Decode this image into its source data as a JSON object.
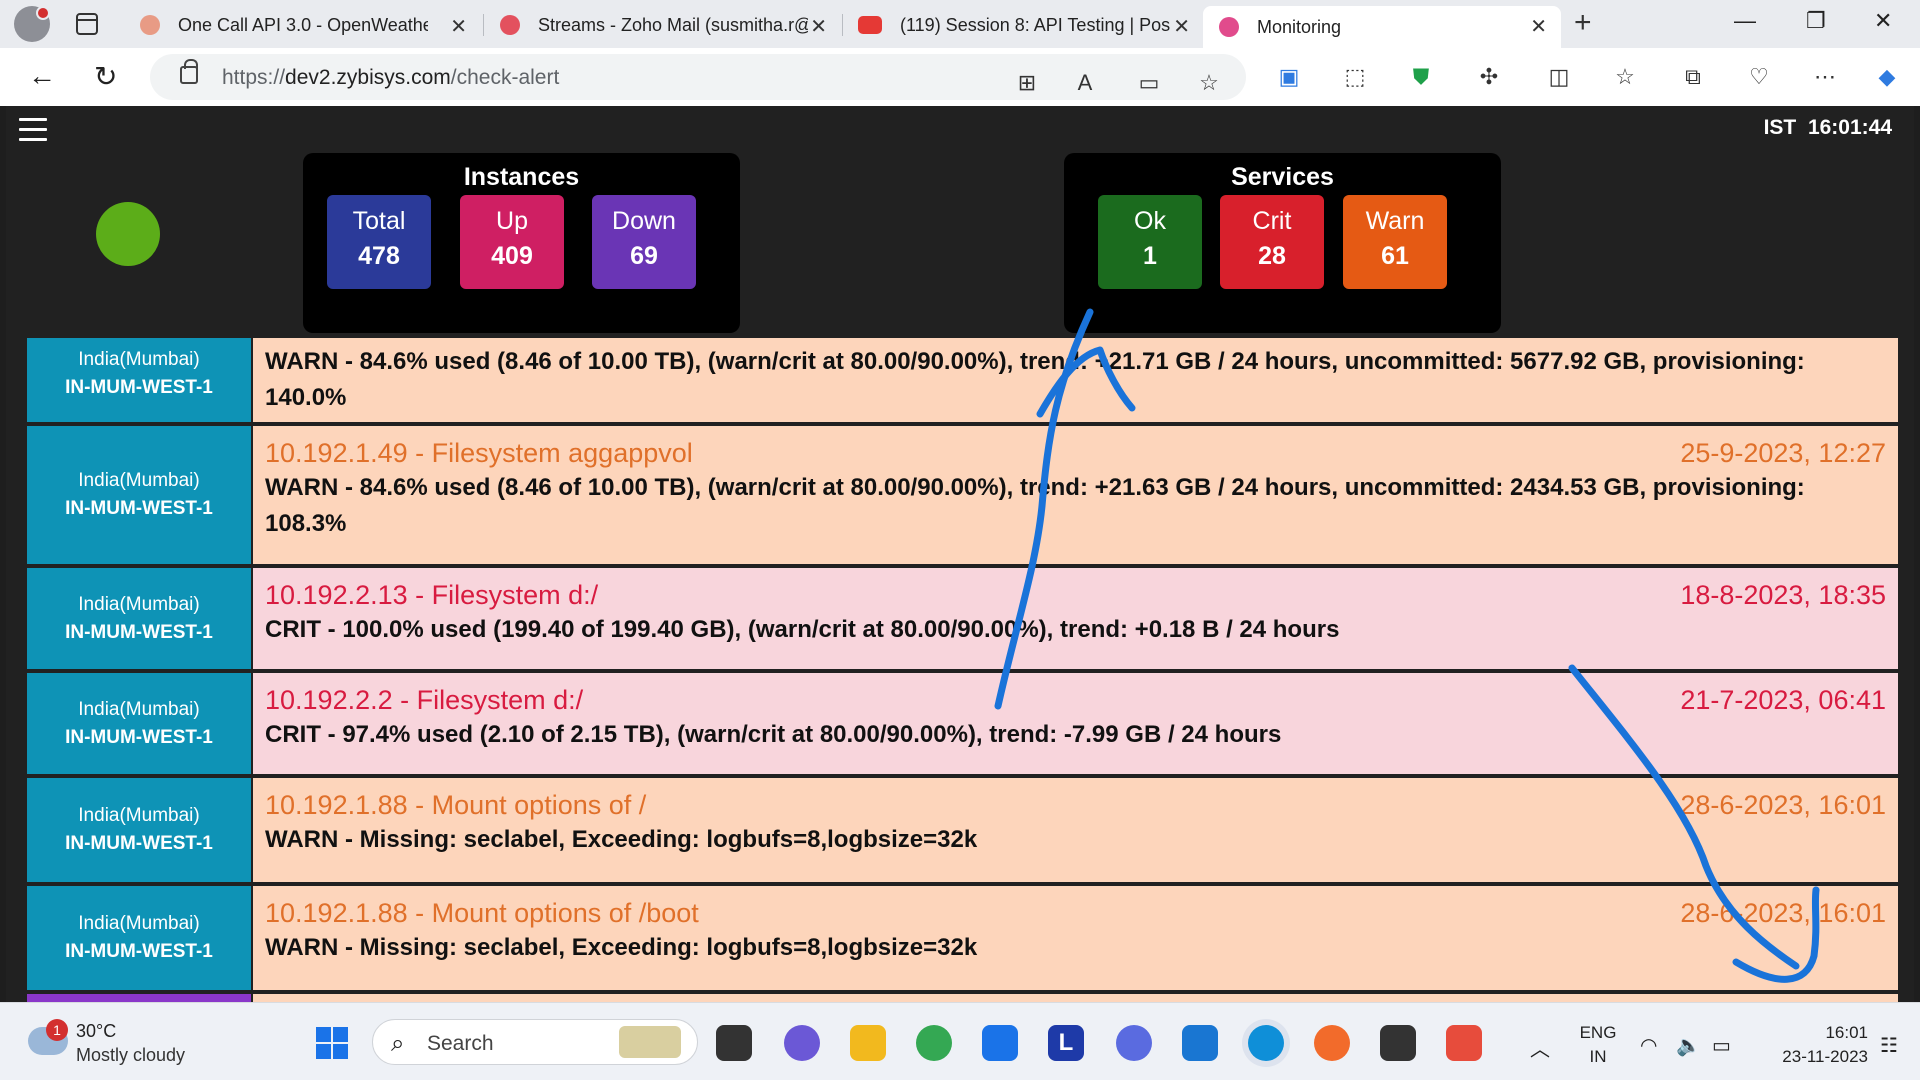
{
  "browser": {
    "tabs": [
      {
        "title": "One Call API 3.0 - OpenWeatherM",
        "favicon_color": "#e89b85"
      },
      {
        "title": "Streams - Zoho Mail (susmitha.r@",
        "favicon_color": "#e3515e"
      },
      {
        "title": "(119) Session 8: API Testing | Post",
        "favicon_color": "#e53935"
      },
      {
        "title": "Monitoring",
        "favicon_color": "#e14b8c"
      }
    ],
    "url_prefix": "https://",
    "url_host": "dev2.zybisys.com",
    "url_path": "/check-alert"
  },
  "header": {
    "timezone": "IST",
    "time": "16:01:44"
  },
  "instances": {
    "title": "Instances",
    "items": [
      {
        "label": "Total",
        "value": "478",
        "color": "#2b3a99"
      },
      {
        "label": "Up",
        "value": "409",
        "color": "#cf1f63"
      },
      {
        "label": "Down",
        "value": "69",
        "color": "#6a35b5"
      }
    ]
  },
  "services": {
    "title": "Services",
    "items": [
      {
        "label": "Ok",
        "value": "1",
        "color": "#1b6b1e"
      },
      {
        "label": "Crit",
        "value": "28",
        "color": "#d8202c"
      },
      {
        "label": "Warn",
        "value": "61",
        "color": "#e55a14"
      }
    ]
  },
  "alerts": [
    {
      "region": "India(Mumbai)",
      "datacenter": "IN-MUM-WEST-1",
      "severity": "warn",
      "title": "",
      "time": "",
      "message": "WARN - 84.6% used (8.46 of 10.00 TB), (warn/crit at 80.00/90.00%), trend: +21.71 GB / 24 hours, uncommitted: 5677.92 GB, provisioning: 140.0%"
    },
    {
      "region": "India(Mumbai)",
      "datacenter": "IN-MUM-WEST-1",
      "severity": "warn",
      "title": "10.192.1.49 - Filesystem aggappvol",
      "time": "25-9-2023, 12:27",
      "message": "WARN - 84.6% used (8.46 of 10.00 TB), (warn/crit at 80.00/90.00%), trend: +21.63 GB / 24 hours, uncommitted: 2434.53 GB, provisioning: 108.3%"
    },
    {
      "region": "India(Mumbai)",
      "datacenter": "IN-MUM-WEST-1",
      "severity": "crit",
      "title": "10.192.2.13 - Filesystem d:/",
      "time": "18-8-2023, 18:35",
      "message": "CRIT - 100.0% used (199.40 of 199.40 GB), (warn/crit at 80.00/90.00%), trend: +0.18 B / 24 hours"
    },
    {
      "region": "India(Mumbai)",
      "datacenter": "IN-MUM-WEST-1",
      "severity": "crit",
      "title": "10.192.2.2 - Filesystem d:/",
      "time": "21-7-2023, 06:41",
      "message": "CRIT - 97.4% used (2.10 of 2.15 TB), (warn/crit at 80.00/90.00%), trend: -7.99 GB / 24 hours"
    },
    {
      "region": "India(Mumbai)",
      "datacenter": "IN-MUM-WEST-1",
      "severity": "warn",
      "title": "10.192.1.88 - Mount options of /",
      "time": "28-6-2023, 16:01",
      "message": "WARN - Missing: seclabel, Exceeding: logbufs=8,logbsize=32k"
    },
    {
      "region": "India(Mumbai)",
      "datacenter": "IN-MUM-WEST-1",
      "severity": "warn",
      "title": "10.192.1.88 - Mount options of /boot",
      "time": "28-6-2023, 16:01",
      "message": "WARN - Missing: seclabel, Exceeding: logbufs=8,logbsize=32k"
    }
  ],
  "partial_region_text": "India(Mumbai)",
  "taskbar": {
    "weather_badge": "1",
    "temperature": "30°C",
    "condition": "Mostly cloudy",
    "search_placeholder": "Search",
    "lang": "ENG",
    "region": "IN",
    "time": "16:01",
    "date": "23-11-2023"
  }
}
